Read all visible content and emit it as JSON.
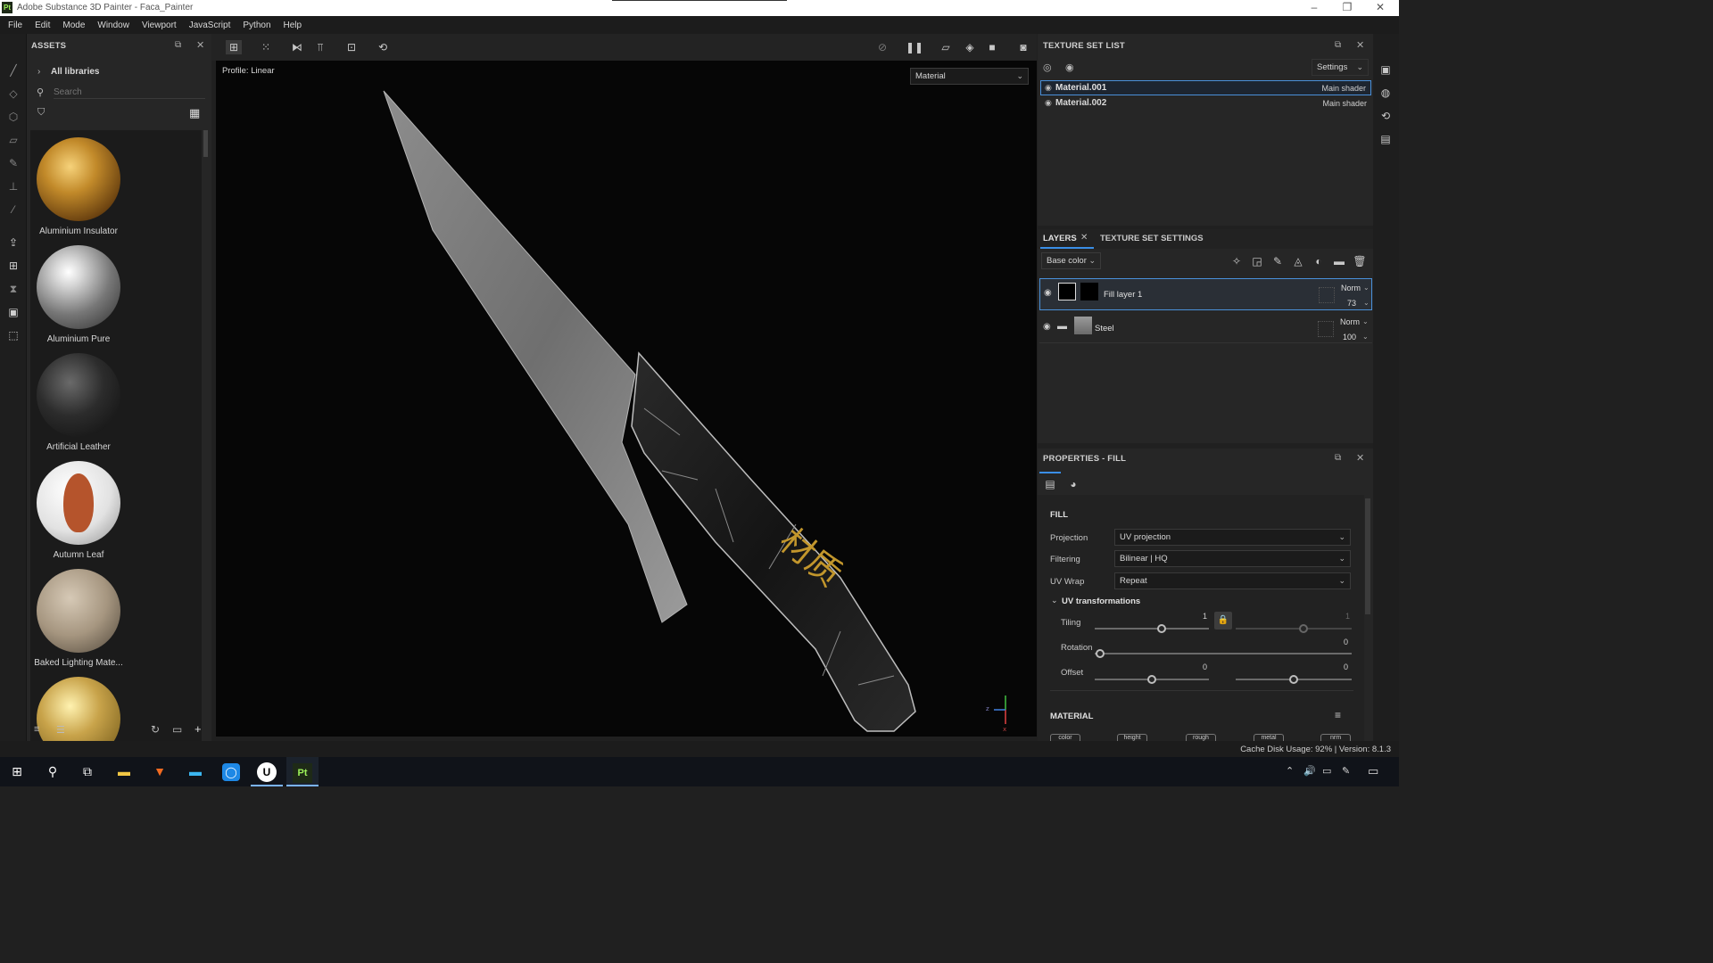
{
  "app": {
    "logo": "Pt",
    "title": "Adobe Substance 3D Painter - Faca_Painter"
  },
  "window_controls": {
    "minimize": "–",
    "maximize": "❐",
    "close": "✕"
  },
  "menu": [
    "File",
    "Edit",
    "Mode",
    "Window",
    "Viewport",
    "JavaScript",
    "Python",
    "Help"
  ],
  "assets": {
    "title": "ASSETS",
    "library": "All libraries",
    "search_placeholder": "Search",
    "items": [
      {
        "name": "Aluminium Insulator"
      },
      {
        "name": "Aluminium Pure"
      },
      {
        "name": "Artificial Leather"
      },
      {
        "name": "Autumn Leaf"
      },
      {
        "name": "Baked Lighting Mate..."
      }
    ]
  },
  "viewport": {
    "profile": "Profile: Linear",
    "mode_select": "Material",
    "engraving": "材质",
    "axis_labels": {
      "z": "z",
      "x": "x"
    }
  },
  "texture_set_list": {
    "title": "TEXTURE SET LIST",
    "settings_label": "Settings",
    "sets": [
      {
        "name": "Material.001",
        "shader": "Main shader",
        "selected": true
      },
      {
        "name": "Material.002",
        "shader": "Main shader",
        "selected": false
      }
    ]
  },
  "layers": {
    "tab_layers": "LAYERS",
    "tab_tss": "TEXTURE SET SETTINGS",
    "channel": "Base color",
    "items": [
      {
        "name": "Fill layer 1",
        "blend": "Norm",
        "opacity": "73",
        "selected": true
      },
      {
        "name": "Steel",
        "blend": "Norm",
        "opacity": "100",
        "selected": false
      }
    ]
  },
  "properties": {
    "title": "PROPERTIES - FILL",
    "section_fill": "FILL",
    "projection_label": "Projection",
    "projection_value": "UV projection",
    "filtering_label": "Filtering",
    "filtering_value": "Bilinear | HQ",
    "uvwrap_label": "UV Wrap",
    "uvwrap_value": "Repeat",
    "uv_transform_label": "UV transformations",
    "tiling_label": "Tiling",
    "tiling_value": "1",
    "tiling_value2": "1",
    "rotation_label": "Rotation",
    "rotation_value": "0",
    "offset_label": "Offset",
    "offset_value_u": "0",
    "offset_value_v": "0",
    "section_material": "MATERIAL",
    "material_channels": [
      "color",
      "height",
      "rough",
      "metal",
      "nrm"
    ]
  },
  "status": {
    "text": "Cache Disk Usage:   92% | Version: 8.1.3"
  },
  "colors": {
    "accent": "#3a8ee6",
    "selected_border": "#4a90d9",
    "gold": "#c2962c"
  }
}
